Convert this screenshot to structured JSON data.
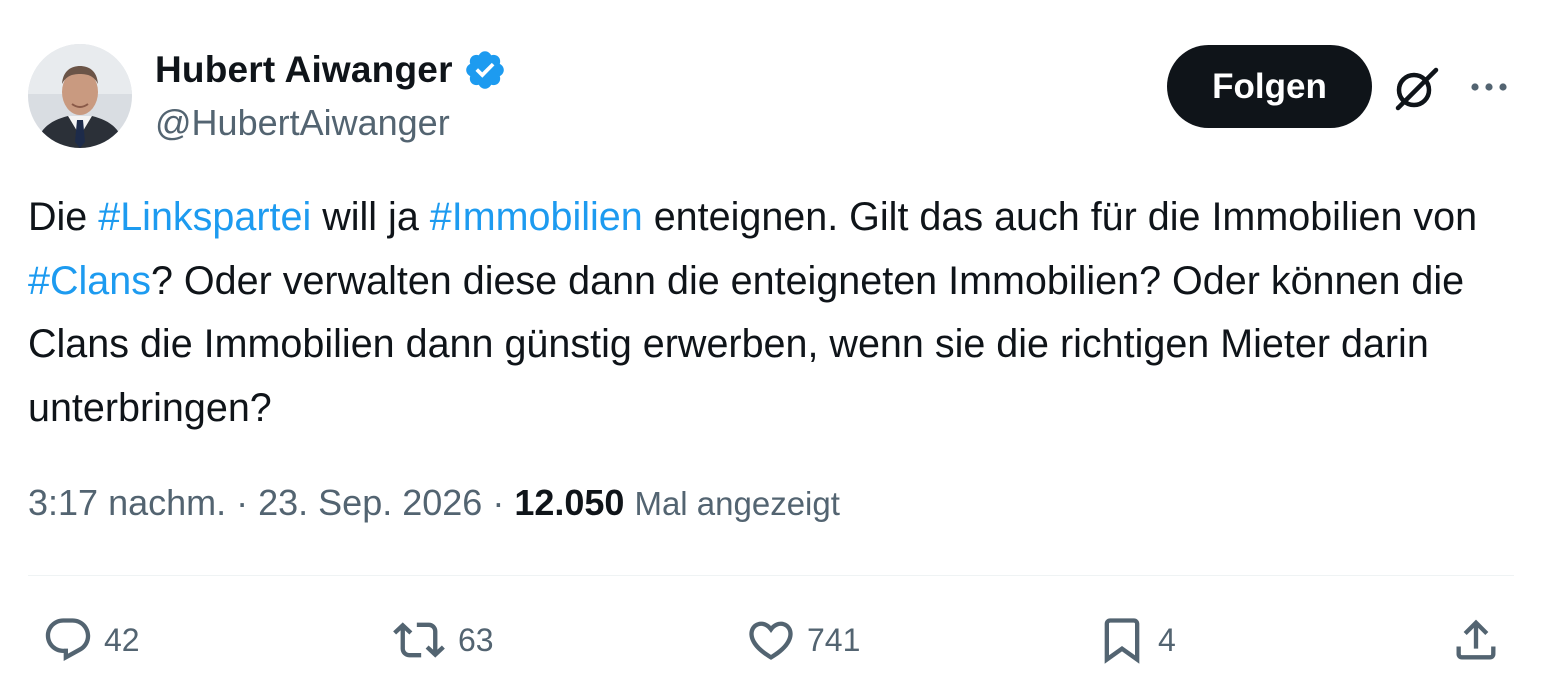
{
  "author": {
    "name": "Hubert Aiwanger",
    "handle": "@HubertAiwanger",
    "verified_color": "#1d9bf0"
  },
  "header": {
    "follow_label": "Folgen",
    "icons": [
      "grok-icon",
      "more-icon"
    ]
  },
  "tweet": {
    "segments": [
      {
        "text": "Die "
      },
      {
        "text": "#Linkspartei",
        "hashtag": true
      },
      {
        "text": " will ja "
      },
      {
        "text": "#Immobilien",
        "hashtag": true
      },
      {
        "text": " enteignen. Gilt das auch für die Immobilien von "
      },
      {
        "text": "#Clans",
        "hashtag": true
      },
      {
        "text": "? Oder verwalten diese dann die enteigneten Immobilien? Oder können die Clans die Immobilien dann günstig erwerben, wenn sie die richtigen Mieter darin unterbringen?"
      }
    ]
  },
  "meta": {
    "time": "3:17 nachm.",
    "separator": " · ",
    "date": "23. Sep. 2026",
    "views_count": "12.050",
    "views_label": "Mal angezeigt"
  },
  "actions": {
    "replies": "42",
    "retweets": "63",
    "likes": "741",
    "bookmarks": "4"
  },
  "colors": {
    "text": "#0f1419",
    "secondary": "#536471",
    "accent": "#1d9bf0",
    "button_bg": "#0f1419"
  }
}
